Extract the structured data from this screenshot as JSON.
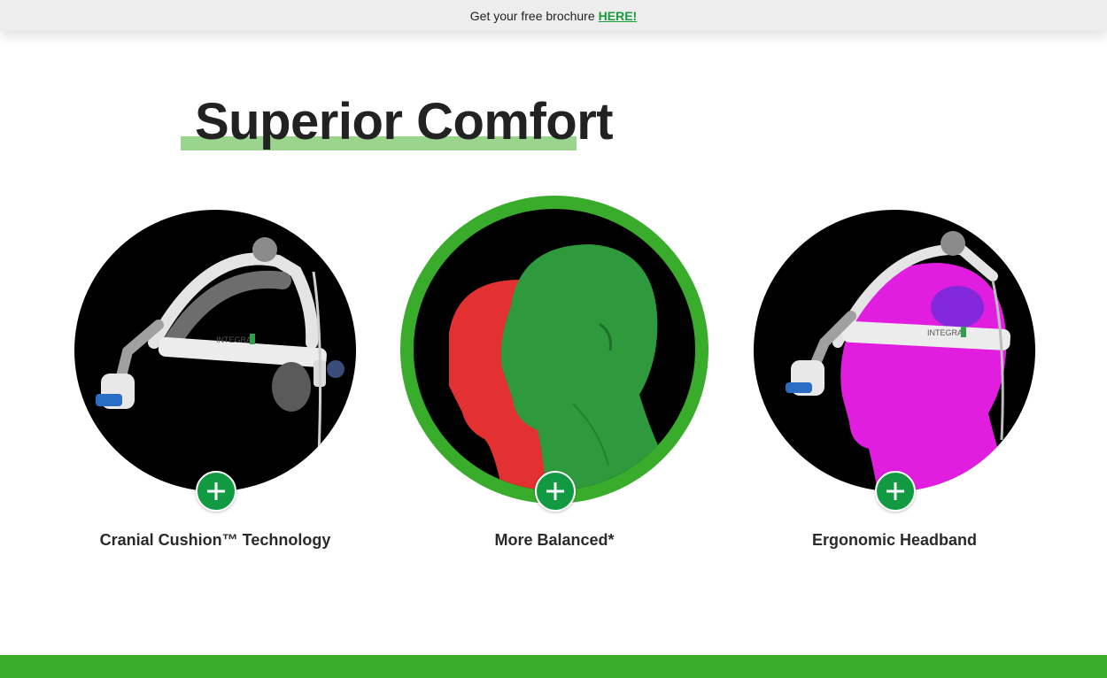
{
  "promo_bar": {
    "text": "Get your free brochure",
    "link": "HERE!"
  },
  "section": {
    "title": "Superior Comfort"
  },
  "cards": [
    {
      "label": "Cranial Cushion™ Technology",
      "icon": "plus-icon"
    },
    {
      "label": "More Balanced*",
      "icon": "plus-icon"
    },
    {
      "label": "Ergonomic Headband",
      "icon": "plus-icon"
    }
  ],
  "images": {
    "card1_brand": "INTEGRA",
    "card3_brand": "INTEGRA"
  },
  "colors": {
    "accent_green": "#129a43",
    "ring_green": "#3aac2b",
    "highlight_green": "#9ad48d",
    "head_red": "#e33030",
    "head_green": "#2e9a3d",
    "head_magenta": "#e11ee0"
  }
}
